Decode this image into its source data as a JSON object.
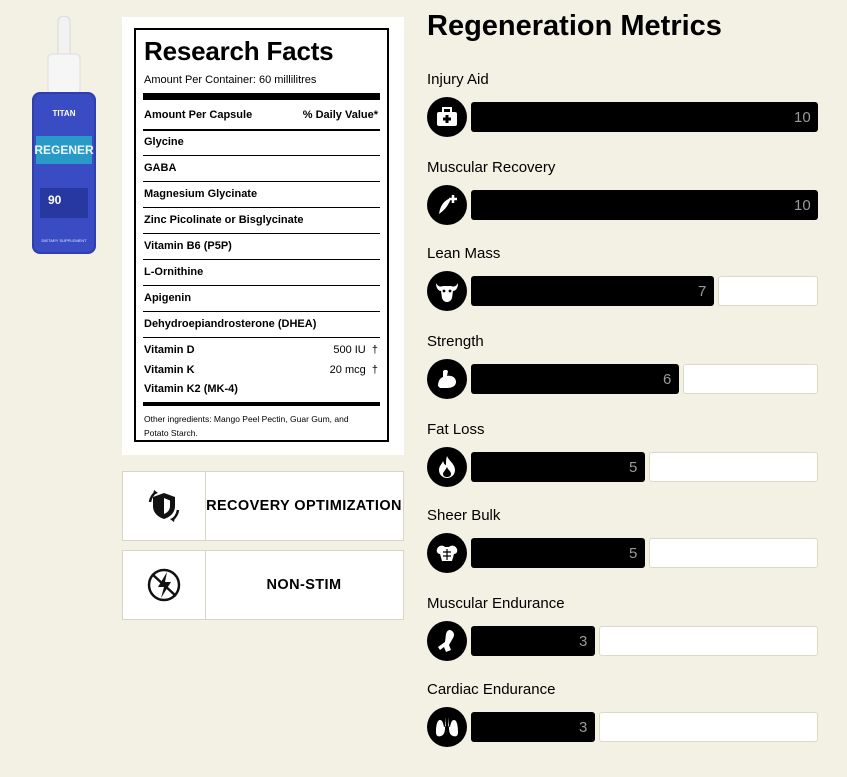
{
  "product": {
    "brand_badge": "TITAN",
    "name_on_bottle": "REGENER",
    "count_on_bottle": "90",
    "bottle_tag": "DIETARY SUPPLEMENT"
  },
  "facts": {
    "title": "Research Facts",
    "subtitle": "Amount Per Container: 60 millilitres",
    "header_left": "Amount Per Capsule",
    "header_right": "% Daily Value*",
    "ingredients": [
      "Glycine",
      "GABA",
      "Magnesium Glycinate",
      "Zinc Picolinate or Bisglycinate",
      "Vitamin B6 (P5P)",
      "L-Ornithine",
      "Apigenin",
      "Dehydroepiandrosterone (DHEA)"
    ],
    "vitamins": [
      {
        "name": "Vitamin D",
        "amount": "500 IU",
        "mark": "†"
      },
      {
        "name": "Vitamin K",
        "amount": "20 mcg",
        "mark": "†"
      },
      {
        "name": "Vitamin K2 (MK-4)",
        "amount": "",
        "mark": ""
      }
    ],
    "footer": "Other ingredients: Mango Peel Pectin, Guar Gum, and Potato Starch."
  },
  "features": [
    {
      "label": "RECOVERY OPTIMIZATION",
      "icon": "shield-refresh-icon"
    },
    {
      "label": "NON-STIM",
      "icon": "no-lightning-icon"
    }
  ],
  "metrics": {
    "title": "Regeneration Metrics",
    "scale_max": 10,
    "items": [
      {
        "label": "Injury Aid",
        "value": 10,
        "icon": "first-aid-kit-icon"
      },
      {
        "label": "Muscular Recovery",
        "value": 10,
        "icon": "muscle-plus-icon"
      },
      {
        "label": "Lean Mass",
        "value": 7,
        "icon": "bull-head-icon"
      },
      {
        "label": "Strength",
        "value": 6,
        "icon": "flexed-arm-icon"
      },
      {
        "label": "Fat Loss",
        "value": 5,
        "icon": "flame-icon"
      },
      {
        "label": "Sheer Bulk",
        "value": 5,
        "icon": "muscular-torso-icon"
      },
      {
        "label": "Muscular Endurance",
        "value": 3,
        "icon": "running-leg-icon"
      },
      {
        "label": "Cardiac Endurance",
        "value": 3,
        "icon": "lungs-icon"
      }
    ]
  },
  "colors": {
    "background": "#f3f0e4",
    "bar_fill": "#000000",
    "bar_value_text": "#9a9a9a",
    "track": "#ffffff"
  }
}
